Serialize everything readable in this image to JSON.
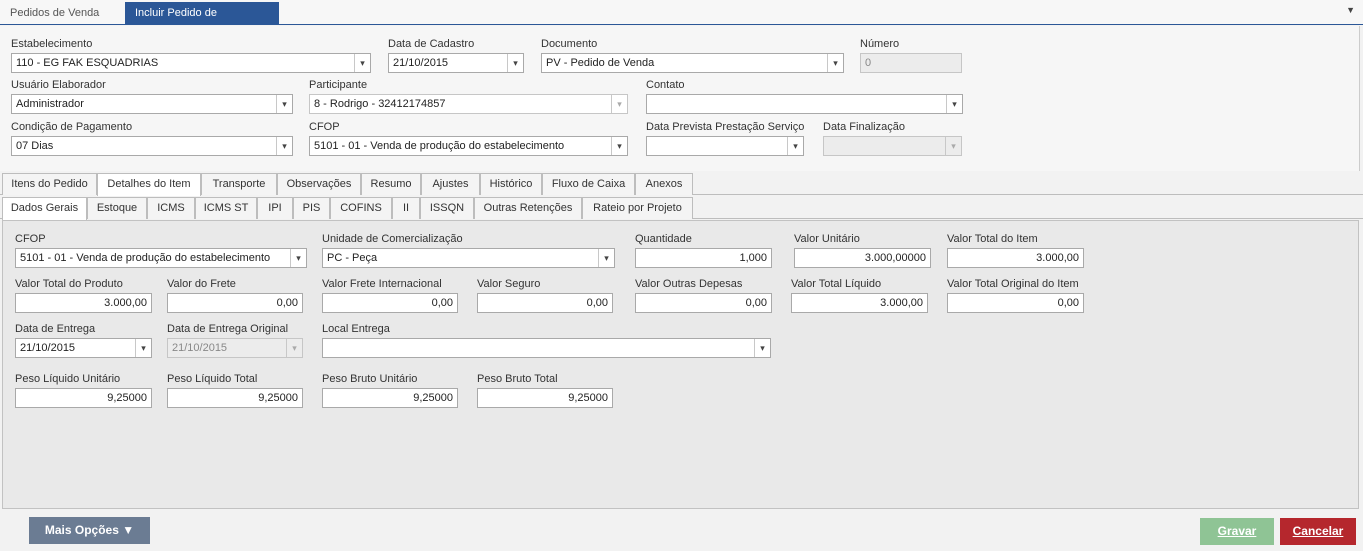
{
  "doc_tabs": [
    {
      "label": "Pedidos de Venda"
    },
    {
      "label": "Incluir Pedido de Venda"
    }
  ],
  "header": {
    "estabelecimento": {
      "label": "Estabelecimento",
      "value": "110 - EG FAK ESQUADRIAS"
    },
    "data_cadastro": {
      "label": "Data de Cadastro",
      "value": "21/10/2015"
    },
    "documento": {
      "label": "Documento",
      "value": "PV - Pedido de Venda"
    },
    "numero": {
      "label": "Número",
      "value": "0"
    },
    "usuario": {
      "label": "Usuário Elaborador",
      "value": "Administrador"
    },
    "participante": {
      "label": "Participante",
      "value": "8 - Rodrigo - 32412174857"
    },
    "contato": {
      "label": "Contato",
      "value": ""
    },
    "condicao": {
      "label": "Condição de Pagamento",
      "value": "07 Dias"
    },
    "cfop": {
      "label": "CFOP",
      "value": "5101 - 01 - Venda de produção do estabelecimento"
    },
    "data_prevista": {
      "label": "Data Prevista Prestação Serviço",
      "value": ""
    },
    "data_finalizacao": {
      "label": "Data Finalização",
      "value": ""
    }
  },
  "main_tabs": [
    "Itens do Pedido",
    "Detalhes do Item",
    "Transporte",
    "Observações",
    "Resumo",
    "Ajustes",
    "Histórico",
    "Fluxo de Caixa",
    "Anexos"
  ],
  "sub_tabs": [
    "Dados Gerais",
    "Estoque",
    "ICMS",
    "ICMS ST",
    "IPI",
    "PIS",
    "COFINS",
    "II",
    "ISSQN",
    "Outras Retenções",
    "Rateio por Projeto"
  ],
  "item": {
    "cfop": {
      "label": "CFOP",
      "value": "5101 - 01 - Venda de produção do estabelecimento"
    },
    "unidade": {
      "label": "Unidade de Comercialização",
      "value": "PC - Peça"
    },
    "quantidade": {
      "label": "Quantidade",
      "value": "1,000"
    },
    "valor_unitario": {
      "label": "Valor Unitário",
      "value": "3.000,00000"
    },
    "valor_total_item": {
      "label": "Valor Total do Item",
      "value": "3.000,00"
    },
    "valor_total_produto": {
      "label": "Valor Total do Produto",
      "value": "3.000,00"
    },
    "valor_frete": {
      "label": "Valor do Frete",
      "value": "0,00"
    },
    "valor_frete_int": {
      "label": "Valor Frete Internacional",
      "value": "0,00"
    },
    "valor_seguro": {
      "label": "Valor Seguro",
      "value": "0,00"
    },
    "valor_outras": {
      "label": "Valor Outras Depesas",
      "value": "0,00"
    },
    "valor_total_liquido": {
      "label": "Valor Total Líquido",
      "value": "3.000,00"
    },
    "valor_total_original": {
      "label": "Valor Total Original do Item",
      "value": "0,00"
    },
    "data_entrega": {
      "label": "Data de Entrega",
      "value": "21/10/2015"
    },
    "data_entrega_original": {
      "label": "Data de Entrega Original",
      "value": "21/10/2015"
    },
    "local_entrega": {
      "label": "Local Entrega",
      "value": ""
    },
    "peso_liq_unit": {
      "label": "Peso Líquido Unitário",
      "value": "9,25000"
    },
    "peso_liq_total": {
      "label": "Peso Líquido Total",
      "value": "9,25000"
    },
    "peso_bruto_unit": {
      "label": "Peso Bruto Unitário",
      "value": "9,25000"
    },
    "peso_bruto_total": {
      "label": "Peso Bruto Total",
      "value": "9,25000"
    }
  },
  "footer": {
    "more_label": "Mais Opções ▼",
    "save_label": "Gravar",
    "cancel_label": "Cancelar"
  },
  "icons": {
    "dropdown": "▾",
    "close": "✕",
    "menu_caret": "▼"
  }
}
